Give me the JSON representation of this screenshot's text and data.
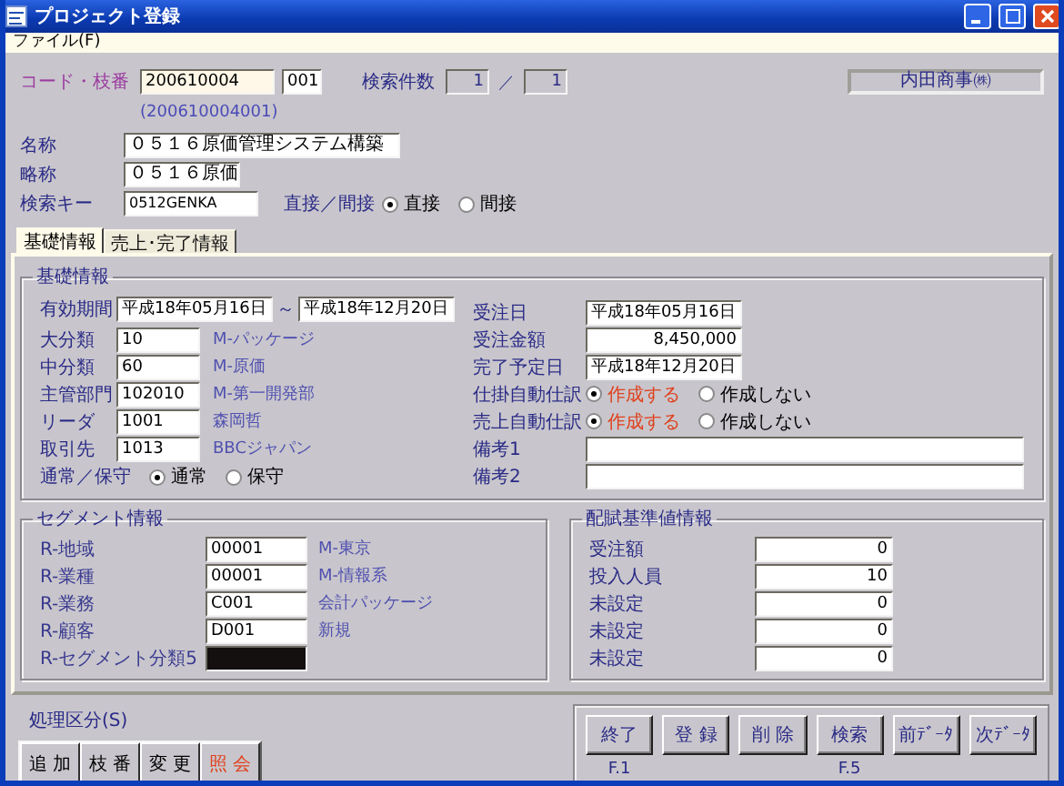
{
  "window": {
    "title": "プロジェクト登録"
  },
  "menu": [
    {
      "label": "ファイル(F)"
    }
  ],
  "header": {
    "code": {
      "label": "コード・枝番",
      "value": "200610004",
      "branch": "001",
      "full": "(200610004001)"
    },
    "search_count": {
      "label": "検索件数",
      "current": "1",
      "separator": "／",
      "total": "1"
    },
    "company": "内田商事㈱",
    "fields": [
      {
        "label": "名称",
        "value": "０５１６原価管理システム構築"
      },
      {
        "label": "略称",
        "value": "０５１６原価"
      },
      {
        "label": "検索キー",
        "value": "0512GENKA"
      }
    ],
    "direct": {
      "label": "直接／間接",
      "options": [
        {
          "label": "直接",
          "selected": true
        },
        {
          "label": "間接",
          "selected": false
        }
      ]
    }
  },
  "tabs": [
    {
      "label": "基礎情報",
      "selected": true
    },
    {
      "label": "売上･完了情報",
      "selected": false
    }
  ],
  "basic": {
    "title": "基礎情報",
    "period": {
      "label": "有効期間",
      "from": "平成18年05月16日",
      "separator": "～",
      "to": "平成18年12月20日"
    },
    "left_rows": [
      {
        "label": "大分類",
        "value": "10",
        "name": "M-パッケージ"
      },
      {
        "label": "中分類",
        "value": "60",
        "name": "M-原価"
      },
      {
        "label": "主管部門",
        "value": "102010",
        "name": "M-第一開発部"
      },
      {
        "label": "リーダ",
        "value": "1001",
        "name": "森岡哲"
      },
      {
        "label": "取引先",
        "value": "1013",
        "name": "BBCジャパン"
      }
    ],
    "normal": {
      "label": "通常／保守",
      "options": [
        {
          "label": "通常",
          "selected": true
        },
        {
          "label": "保守",
          "selected": false
        }
      ]
    },
    "right_rows": [
      {
        "kind": "text",
        "label": "受注日",
        "value": "平成18年05月16日"
      },
      {
        "kind": "amount",
        "label": "受注金額",
        "value": "8,450,000"
      },
      {
        "kind": "text",
        "label": "完了予定日",
        "value": "平成18年12月20日"
      },
      {
        "kind": "radio",
        "label": "仕掛自動仕訳",
        "options": [
          {
            "label": "作成する",
            "selected": true
          },
          {
            "label": "作成しない",
            "selected": false
          }
        ]
      },
      {
        "kind": "radio",
        "label": "売上自動仕訳",
        "options": [
          {
            "label": "作成する",
            "selected": true
          },
          {
            "label": "作成しない",
            "selected": false
          }
        ]
      },
      {
        "kind": "memo",
        "label": "備考1"
      },
      {
        "kind": "memo",
        "label": "備考2"
      }
    ]
  },
  "segment": {
    "title": "セグメント情報",
    "rows": [
      {
        "kind": "text",
        "label": "R-地域",
        "value": "00001",
        "name": "M-東京"
      },
      {
        "kind": "text",
        "label": "R-業種",
        "value": "00001",
        "name": "M-情報系"
      },
      {
        "kind": "text",
        "label": "R-業務",
        "value": "C001",
        "name": "会計パッケージ"
      },
      {
        "kind": "text",
        "label": "R-顧客",
        "value": "D001",
        "name": "新規"
      },
      {
        "kind": "blocked",
        "label": "R-セグメント分類5"
      }
    ]
  },
  "allocation": {
    "title": "配賦基準値情報",
    "rows": [
      {
        "label": "受注額",
        "value": "0"
      },
      {
        "label": "投入人員",
        "value": "10"
      },
      {
        "label": "未設定",
        "value": "0"
      },
      {
        "label": "未設定",
        "value": "0"
      },
      {
        "label": "未設定",
        "value": "0"
      }
    ]
  },
  "process": {
    "label": "処理区分(S)",
    "buttons": [
      {
        "label": "追 加",
        "selected": false
      },
      {
        "label": "枝 番",
        "selected": false
      },
      {
        "label": "変 更",
        "selected": false
      },
      {
        "label": "照 会",
        "selected": true
      }
    ]
  },
  "actions": [
    {
      "label": "終了",
      "shortcut": "F.1"
    },
    {
      "label": "登 録"
    },
    {
      "label": "削 除"
    },
    {
      "label": "検索",
      "shortcut": "F.5"
    },
    {
      "label": "前ﾃﾞｰﾀ"
    },
    {
      "label": "次ﾃﾞｰﾀ"
    }
  ]
}
